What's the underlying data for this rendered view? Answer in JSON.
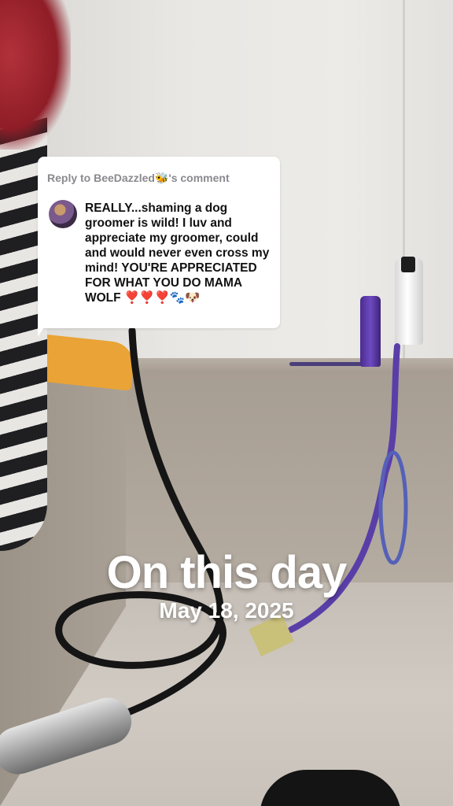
{
  "comment": {
    "reply_prefix": "Reply to BeeDazzled",
    "reply_emoji": "🐝",
    "reply_suffix": "'s comment",
    "body": "REALLY...shaming a dog groomer is wild! I luv and appreciate my groomer, could and would never even cross my mind! YOU'RE APPRECIATED FOR WHAT YOU DO MAMA WOLF",
    "body_emojis": "❣️❣️❣️🐾🐶"
  },
  "overlay": {
    "title": "On this day",
    "date": "May 18, 2025"
  },
  "colors": {
    "overlay_text": "#ffffff",
    "card_bg": "#ffffff",
    "reply_text": "#8a8a8f"
  }
}
